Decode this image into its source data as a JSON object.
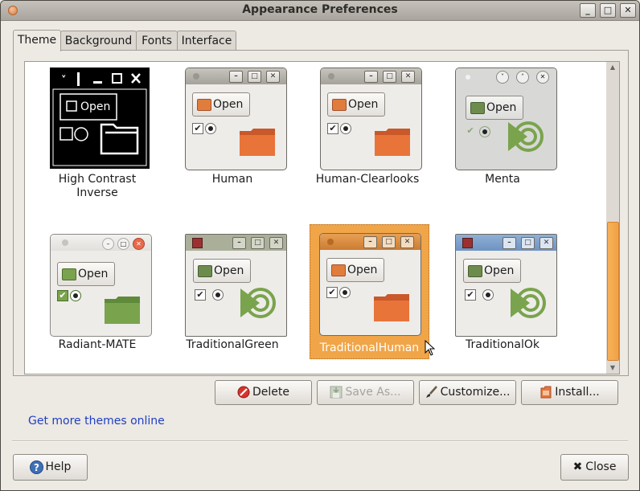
{
  "window": {
    "title": "Appearance Preferences",
    "buttons": {
      "minimize": "_",
      "maximize": "□",
      "close": "✕"
    }
  },
  "tabs": [
    {
      "label": "Theme",
      "active": true
    },
    {
      "label": "Background",
      "active": false
    },
    {
      "label": "Fonts",
      "active": false
    },
    {
      "label": "Interface",
      "active": false
    }
  ],
  "themes": [
    {
      "name": "High Contrast Inverse",
      "style": "hc",
      "open_label": "Open"
    },
    {
      "name": "Human",
      "style": "human",
      "open_label": "Open"
    },
    {
      "name": "Human-Clearlooks",
      "style": "human",
      "open_label": "Open"
    },
    {
      "name": "Menta",
      "style": "menta",
      "open_label": "Open"
    },
    {
      "name": "Radiant-MATE",
      "style": "radiant",
      "open_label": "Open"
    },
    {
      "name": "TraditionalGreen",
      "style": "tgreen",
      "open_label": "Open"
    },
    {
      "name": "TraditionalHuman",
      "style": "thuman",
      "open_label": "Open",
      "selected": true
    },
    {
      "name": "TraditionalOk",
      "style": "tok",
      "open_label": "Open"
    }
  ],
  "actions": {
    "delete": "Delete",
    "save_as": "Save As...",
    "customize": "Customize...",
    "install": "Install..."
  },
  "link": "Get more themes online",
  "footer": {
    "help": "Help",
    "close": "Close"
  },
  "colors": {
    "accent": "#f0a548",
    "link": "#1f40c4",
    "human_folder": "#e8743a",
    "green_folder": "#7aa34d"
  }
}
